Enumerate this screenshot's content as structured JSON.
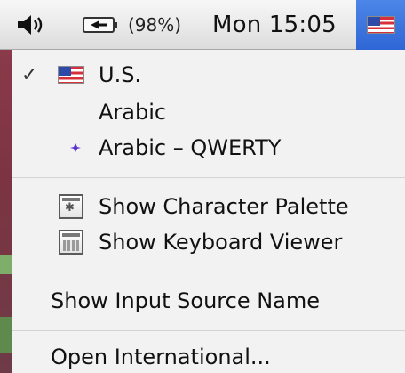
{
  "menubar": {
    "battery_percent": "(98%)",
    "clock": "Mon 15:05"
  },
  "menu": {
    "input_sources": [
      {
        "label": "U.S.",
        "icon": "us-flag-icon",
        "checked": true
      },
      {
        "label": "Arabic",
        "icon": "crescent-moon-icon",
        "checked": false
      },
      {
        "label": "Arabic – QWERTY",
        "icon": "crescent-moon-star-icon",
        "checked": false
      }
    ],
    "tools": [
      {
        "label": "Show Character Palette",
        "icon": "character-palette-icon"
      },
      {
        "label": "Show Keyboard Viewer",
        "icon": "keyboard-viewer-icon"
      }
    ],
    "show_input_source_name": "Show Input Source Name",
    "open_international": "Open International..."
  },
  "colors": {
    "crescent_green": "#1f7a1f",
    "flag_cell_blue": "#3a73de",
    "menu_background": "#f2f2f2"
  }
}
